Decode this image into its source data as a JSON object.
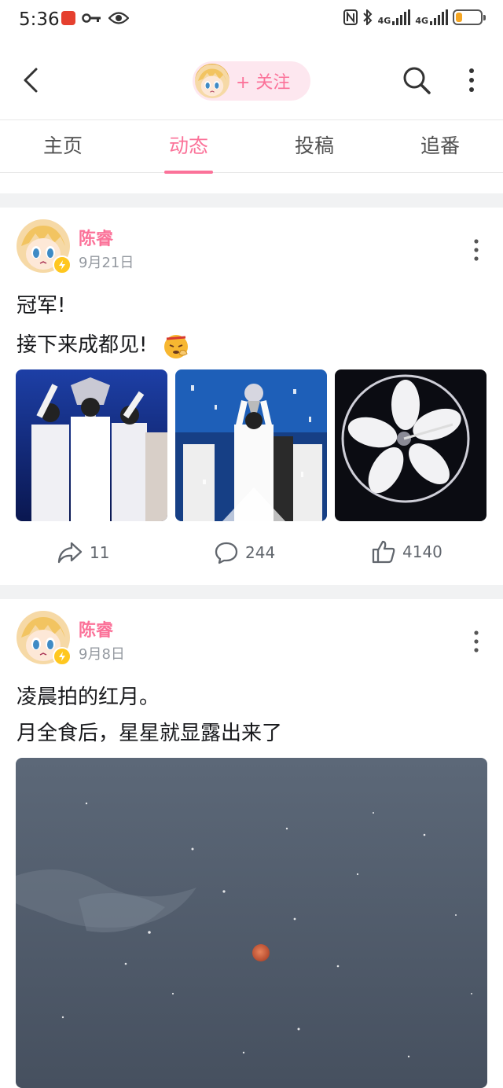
{
  "status_bar": {
    "time": "5:36",
    "network_label_1": "4G",
    "network_label_2": "4G",
    "battery_level_percent": 25,
    "battery_color": "#f5a623"
  },
  "header": {
    "follow_label": "+ 关注",
    "icons": [
      "back-icon",
      "search-icon",
      "more-vertical-icon"
    ]
  },
  "tabs": [
    {
      "label": "主页",
      "active": false
    },
    {
      "label": "动态",
      "active": true
    },
    {
      "label": "投稿",
      "active": false
    },
    {
      "label": "追番",
      "active": false
    }
  ],
  "accent_color": "#fb7299",
  "posts": [
    {
      "author": "陈睿",
      "date": "9月21日",
      "lines": [
        "冠军!",
        "接下来成都见!"
      ],
      "emoji": "😤",
      "images": [
        "trophy-celebration-photo",
        "trophy-raised-photo",
        "team-circle-overhead-photo"
      ],
      "actions": {
        "share": "11",
        "comment": "244",
        "like": "4140"
      }
    },
    {
      "author": "陈睿",
      "date": "9月8日",
      "lines": [
        "凌晨拍的红月。",
        "月全食后，星星就显露出来了"
      ],
      "images": [
        "red-moon-night-sky-photo"
      ]
    }
  ]
}
